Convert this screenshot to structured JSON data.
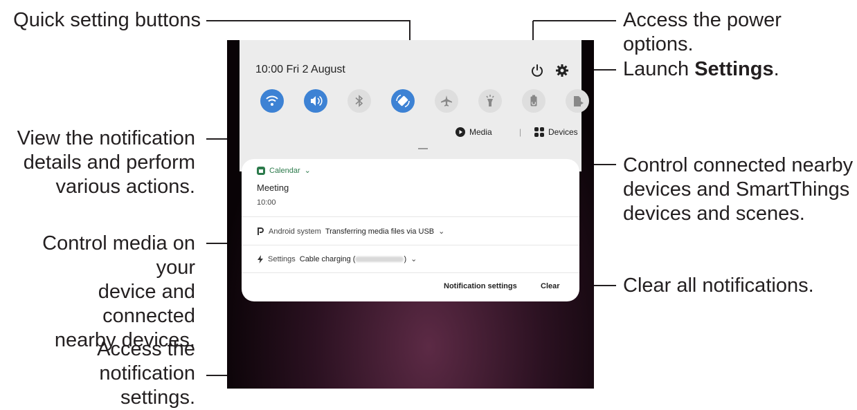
{
  "callouts": {
    "quick_settings": "Quick setting buttons",
    "power": "Access the power options.",
    "settings_prefix": "Launch ",
    "settings_bold": "Settings",
    "settings_suffix": ".",
    "notif_details_1": "View the notification",
    "notif_details_2": "details and perform",
    "notif_details_3": "various actions.",
    "devices_1": "Control connected nearby",
    "devices_2": "devices and SmartThings",
    "devices_3": "devices and scenes.",
    "media_1": "Control media on your",
    "media_2": "device and connected",
    "media_3": "nearby devices.",
    "clear_all": "Clear all notifications.",
    "notif_settings_1": "Access the notification",
    "notif_settings_2": "settings."
  },
  "phone": {
    "status_time": "10:00  Fri 2 August",
    "quick_buttons": [
      {
        "icon": "wifi-icon",
        "state": "on"
      },
      {
        "icon": "sound-icon",
        "state": "on"
      },
      {
        "icon": "bluetooth-icon",
        "state": "off"
      },
      {
        "icon": "auto-rotate-icon",
        "state": "on"
      },
      {
        "icon": "airplane-icon",
        "state": "off"
      },
      {
        "icon": "flashlight-icon",
        "state": "off"
      },
      {
        "icon": "power-saving-icon",
        "state": "off"
      },
      {
        "icon": "mobile-data-icon",
        "state": "off"
      }
    ],
    "media_label": "Media",
    "separator": "|",
    "devices_label": "Devices",
    "notifications": {
      "calendar_app": "Calendar",
      "calendar_title": "Meeting",
      "calendar_time": "10:00",
      "android_app": "Android system",
      "android_text": "Transferring media files via USB",
      "settings_app": "Settings",
      "settings_text_start": "Cable charging (",
      "settings_text_end": ")"
    },
    "notification_settings_label": "Notification settings",
    "clear_label": "Clear"
  },
  "colors": {
    "accent_on": "#3d82d4",
    "off": "#dedede",
    "calendar_green": "#2c7a4b"
  }
}
